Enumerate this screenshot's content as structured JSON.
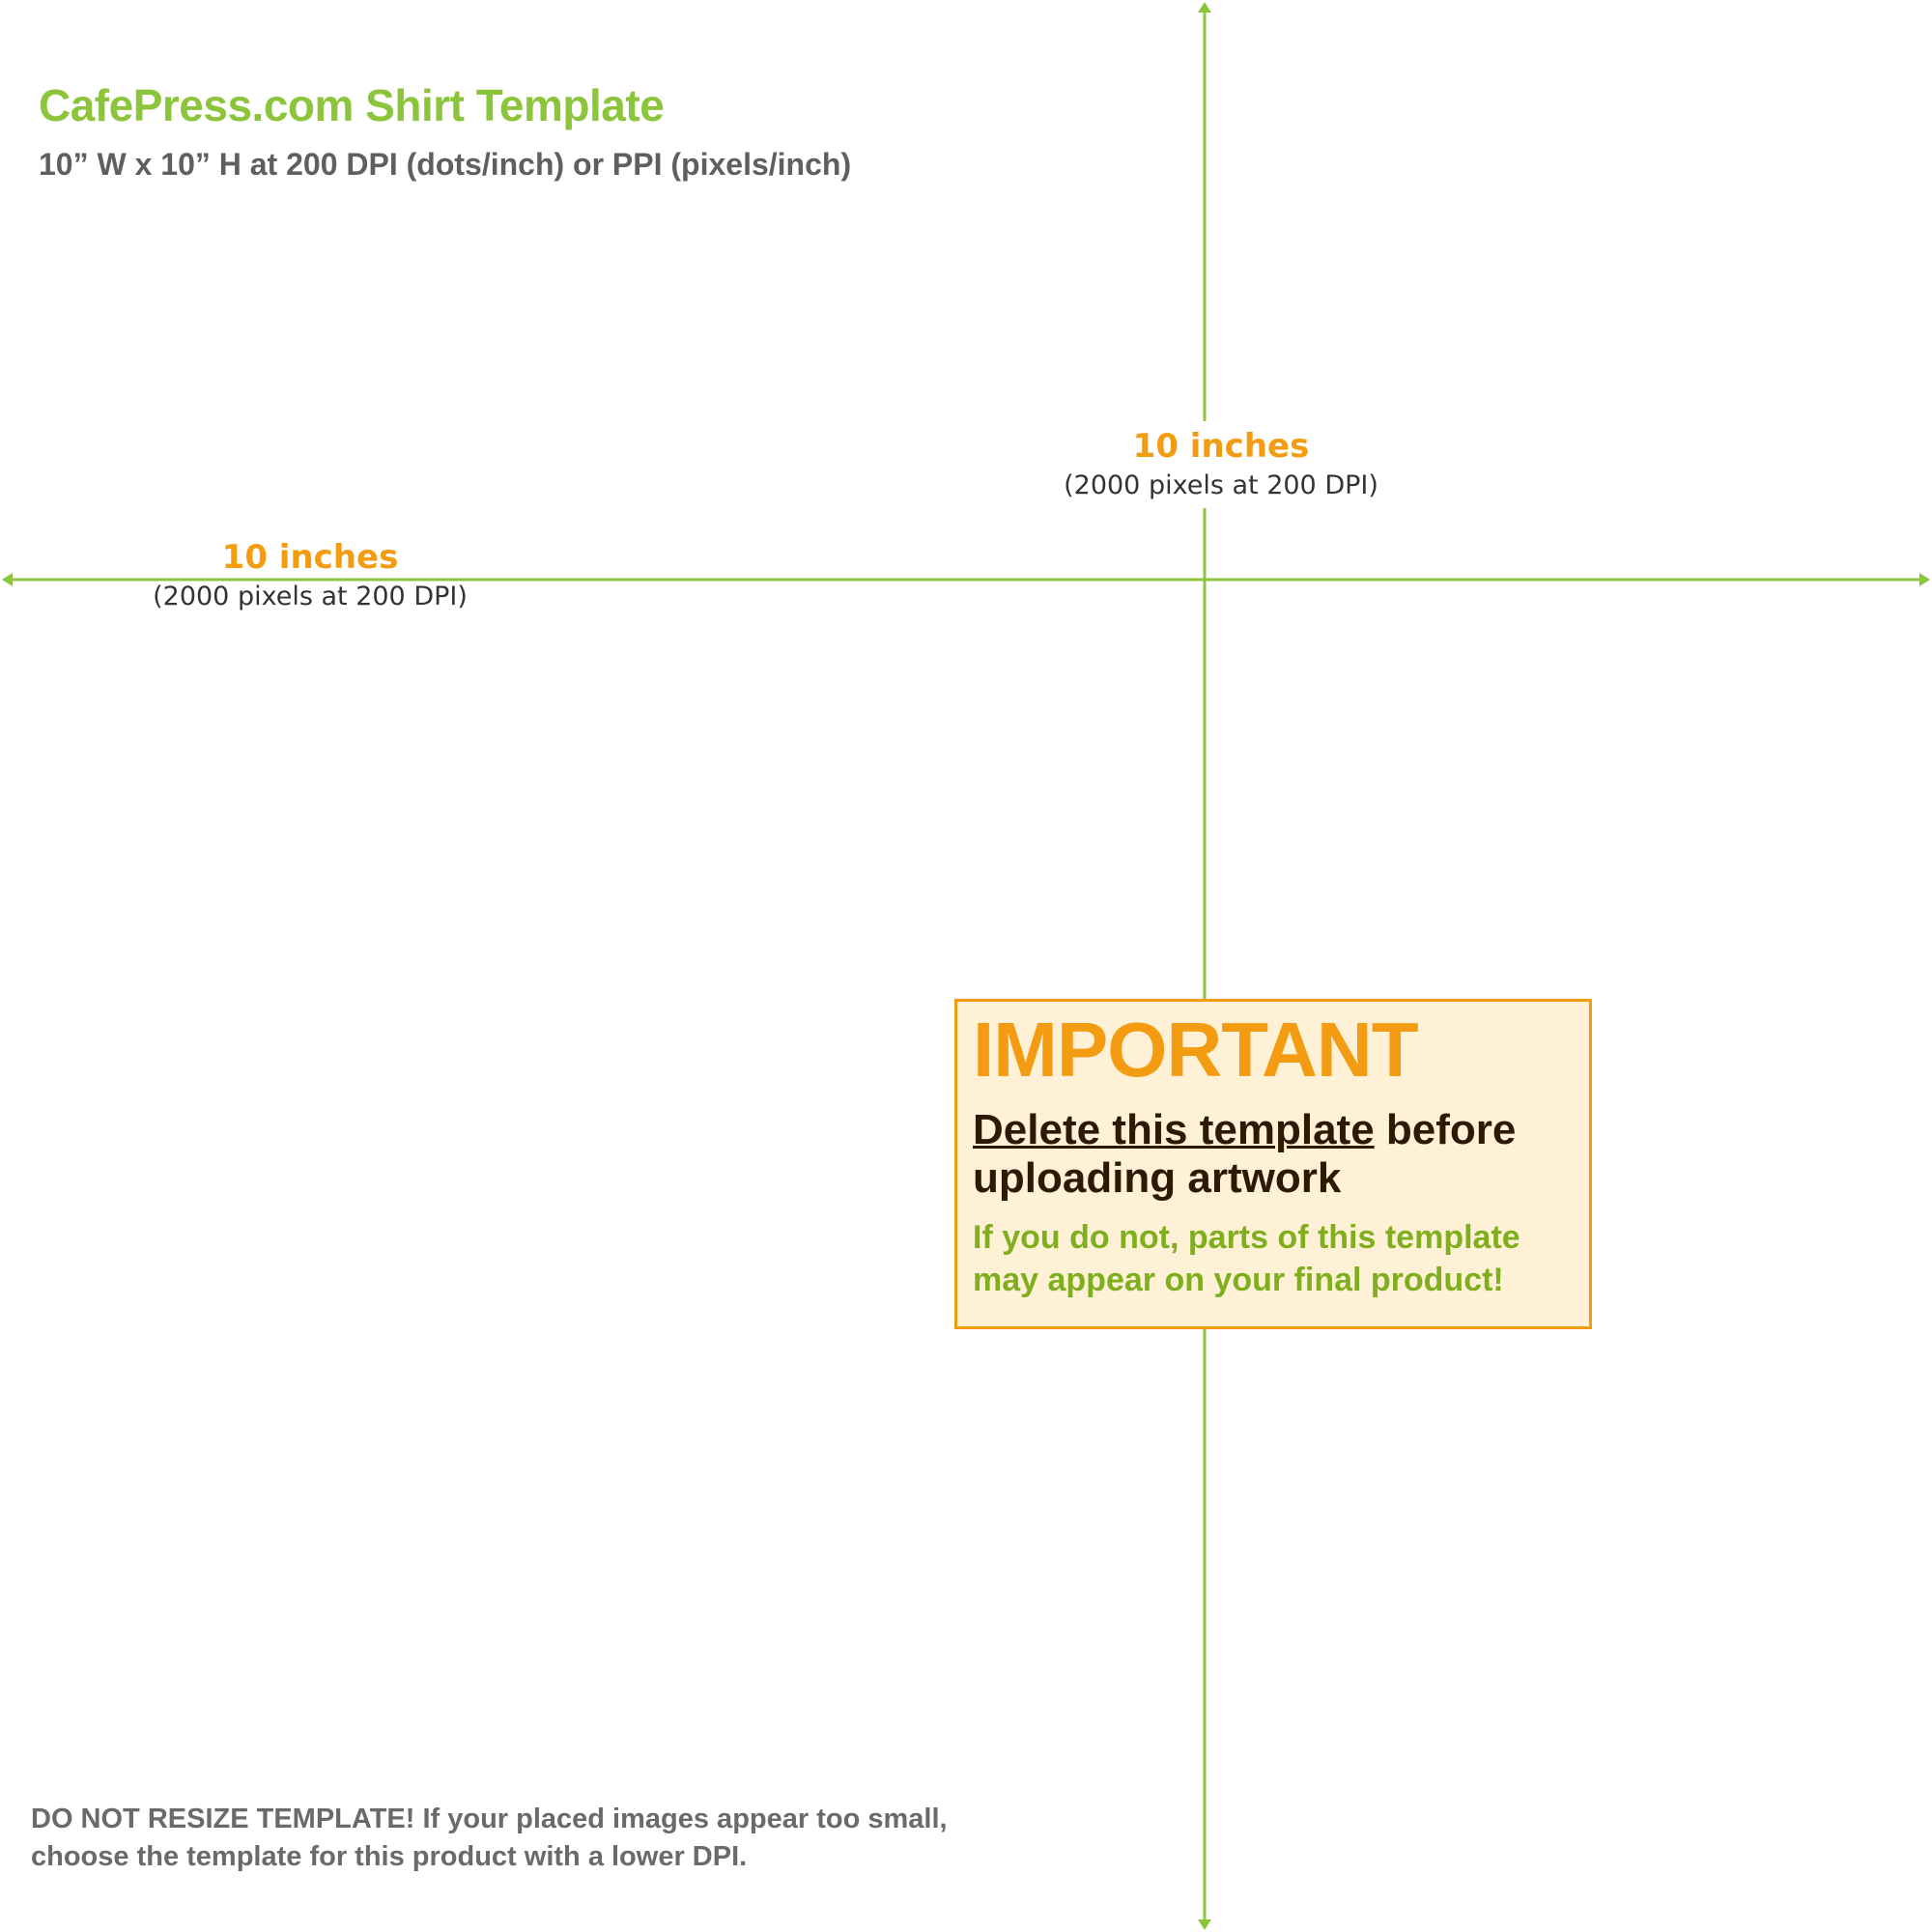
{
  "header": {
    "title": "CafePress.com Shirt Template",
    "subtitle": "10” W x 10” H at 200 DPI (dots/inch) or PPI (pixels/inch)"
  },
  "dimensions": {
    "vertical": {
      "inches": "10 inches",
      "pixels": "(2000 pixels at 200 DPI)"
    },
    "horizontal": {
      "inches": "10 inches",
      "pixels": "(2000 pixels at 200 DPI)"
    }
  },
  "important_box": {
    "heading": "IMPORTANT",
    "instruction_underlined": "Delete this template",
    "instruction_rest": " before uploading artwork",
    "warning": "If you do not, parts of this template may appear on your final product!"
  },
  "footer": {
    "note": "DO NOT RESIZE TEMPLATE! If your placed images appear too small, choose the template for this product with a lower DPI."
  },
  "colors": {
    "guide_green": "#8cc43c",
    "accent_orange": "#f39c12",
    "box_fill": "#fff1d6"
  }
}
